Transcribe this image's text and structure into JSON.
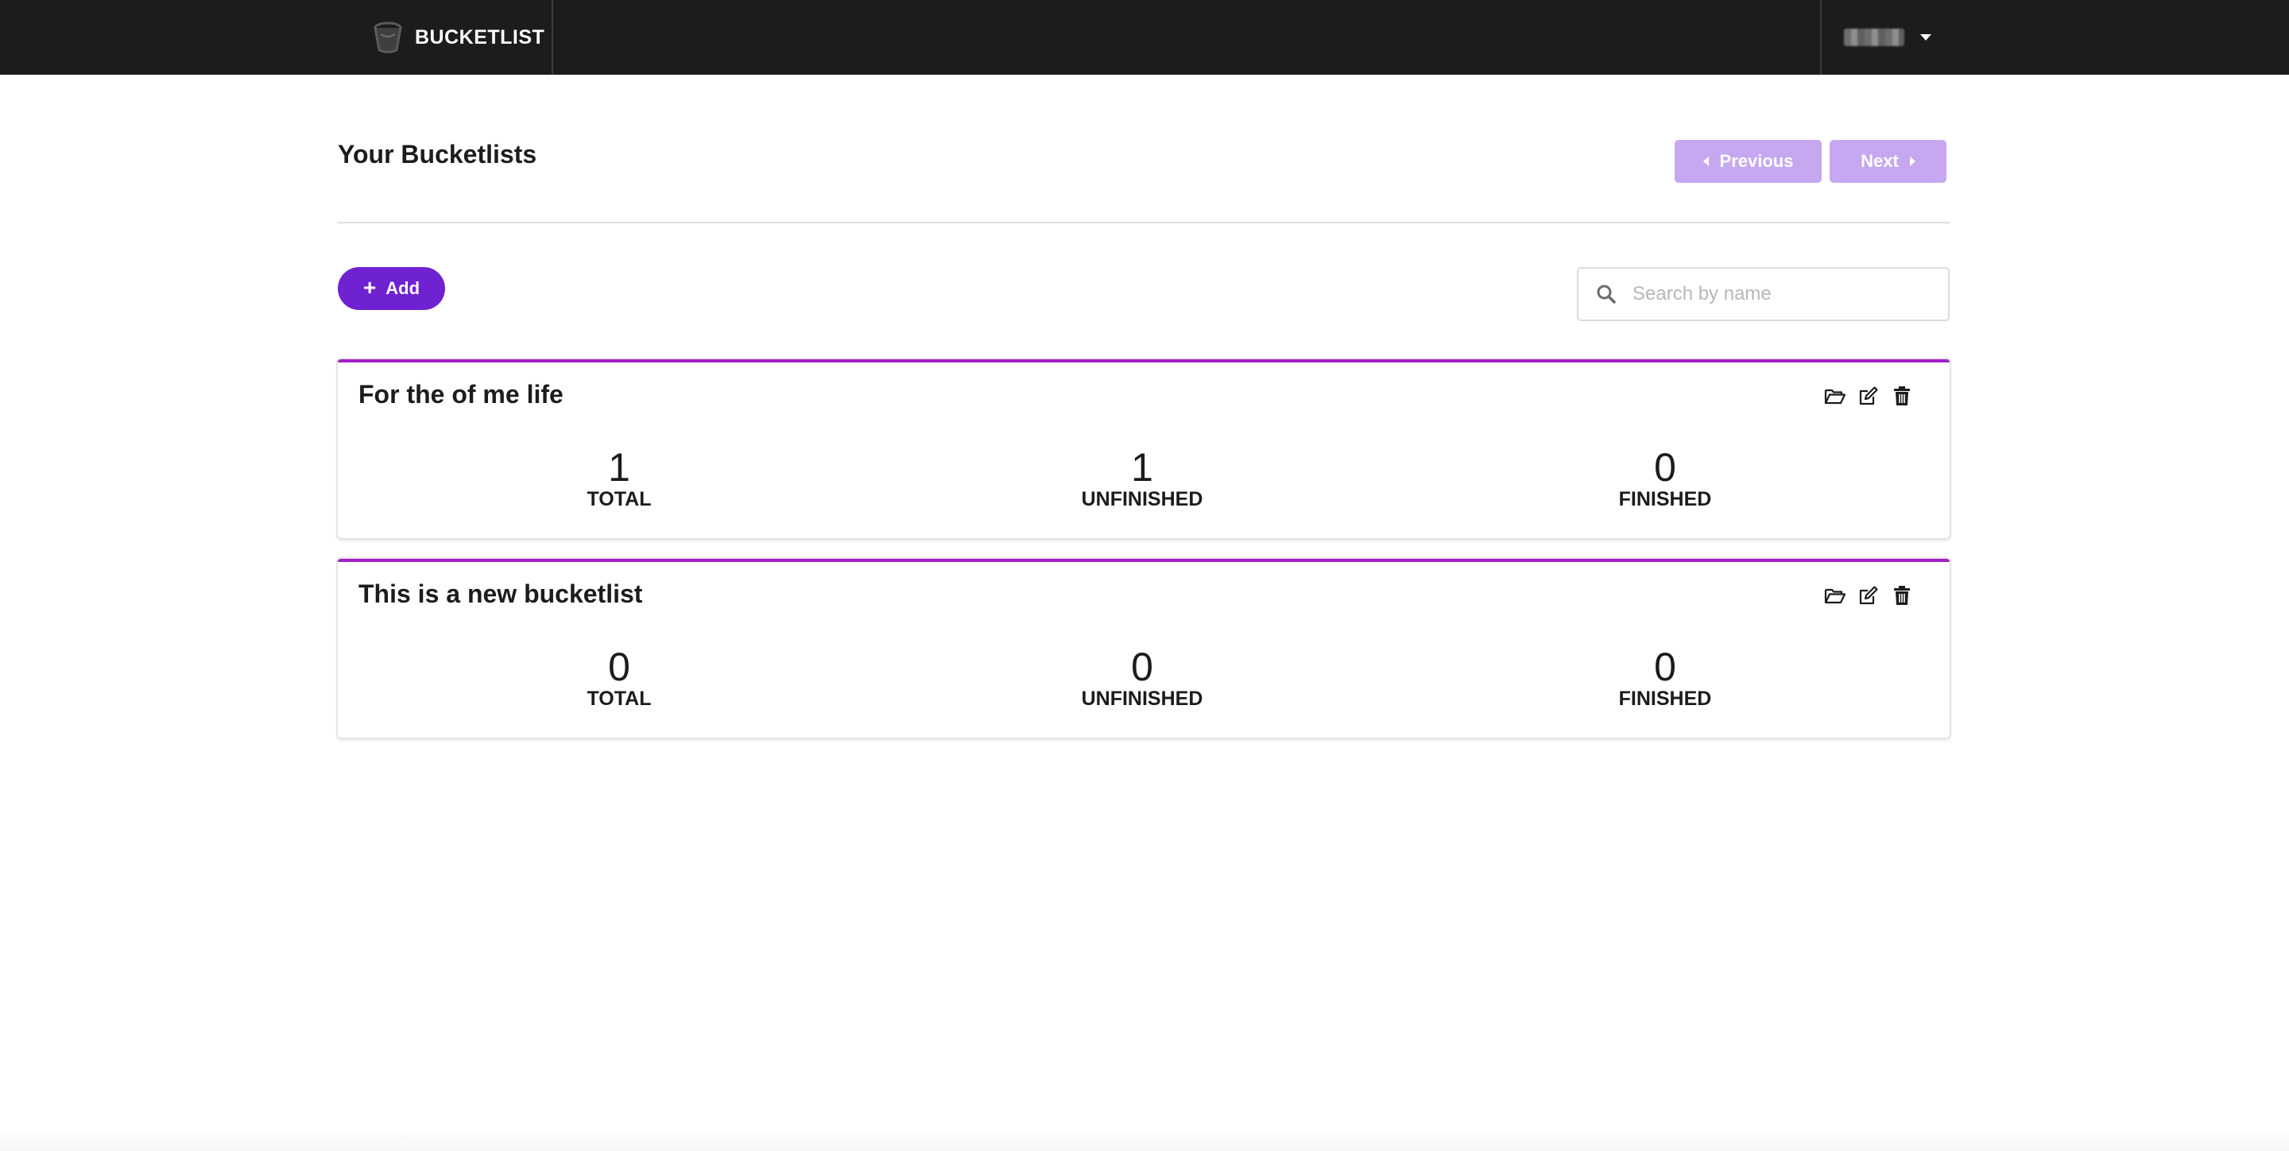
{
  "navbar": {
    "brand_text": "BUCKETLIST",
    "brand_icon": "bucket-logo-icon",
    "user_caret_icon": "caret-down-icon"
  },
  "page": {
    "title": "Your Bucketlists",
    "previous_label": "Previous",
    "next_label": "Next"
  },
  "toolbar": {
    "add_label": "Add",
    "search_placeholder": "Search by name",
    "search_value": ""
  },
  "bucketlists": [
    {
      "name": "For the of me life",
      "stats": [
        {
          "value": "1",
          "label": "TOTAL"
        },
        {
          "value": "1",
          "label": "UNFINISHED"
        },
        {
          "value": "0",
          "label": "FINISHED"
        }
      ]
    },
    {
      "name": "This is a new bucketlist",
      "stats": [
        {
          "value": "0",
          "label": "TOTAL"
        },
        {
          "value": "0",
          "label": "UNFINISHED"
        },
        {
          "value": "0",
          "label": "FINISHED"
        }
      ]
    }
  ],
  "card_actions": [
    "open-folder-icon",
    "edit-icon",
    "trash-icon"
  ],
  "colors": {
    "navbar_bg": "#1b1c1d",
    "accent_purple": "#6f22d2",
    "card_border": "#a21fc7",
    "pager_disabled": "#c6a8f0"
  }
}
